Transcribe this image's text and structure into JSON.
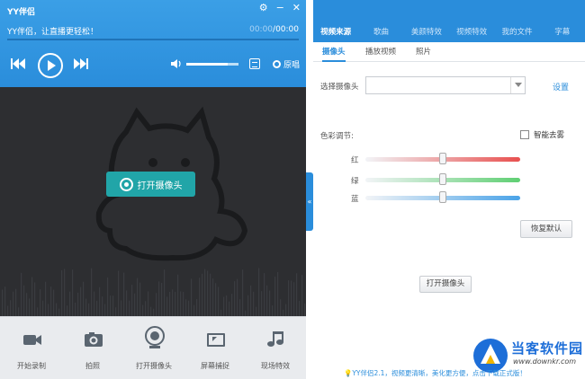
{
  "window": {
    "title": "YY伴侣",
    "controls": [
      "gear-icon",
      "minimize-icon",
      "close-icon"
    ]
  },
  "player": {
    "slogan": "YY伴侣，让直播更轻松！",
    "time_current": "00:00",
    "time_total": "/00:00",
    "volume_level": 0.8,
    "original_label": "原唱",
    "original_selected": true
  },
  "preview": {
    "open_camera_label": "打开摄像头"
  },
  "toolbar": {
    "items": [
      {
        "label": "开始录制",
        "icon": "record-video-icon"
      },
      {
        "label": "拍照",
        "icon": "camera-icon"
      },
      {
        "label": "打开摄像头",
        "icon": "webcam-icon"
      },
      {
        "label": "屏幕捕捉",
        "icon": "screen-capture-icon"
      },
      {
        "label": "现场特效",
        "icon": "music-note-icon"
      }
    ]
  },
  "collapse_label": "«",
  "right": {
    "tabs": [
      "视频来源",
      "歌曲",
      "美颜特效",
      "视频特效",
      "我的文件",
      "字幕"
    ],
    "active_tab": 0,
    "subtabs": [
      "摄像头",
      "播放视频",
      "照片"
    ],
    "active_subtab": 0,
    "select_camera_label": "选择摄像头",
    "select_camera_value": "",
    "settings_link": "设置",
    "color_adjust_label": "色彩调节:",
    "defog_label": "智能去雾",
    "defog_checked": false,
    "sliders": [
      {
        "label": "红",
        "value": 0.5,
        "color_from": "#f2f4f7",
        "color_to": "#e8504f"
      },
      {
        "label": "绿",
        "value": 0.5,
        "color_from": "#f2f4f7",
        "color_to": "#5fcf73"
      },
      {
        "label": "蓝",
        "value": 0.5,
        "color_from": "#f2f4f7",
        "color_to": "#4aa3e8"
      }
    ],
    "restore_default": "恢复默认",
    "open_camera_button": "打开摄像头"
  },
  "footer": {
    "tip": "YY伴侣2.1，视频更清晰，美化更方便，点击下载正式版！",
    "brand_name": "当客软件园",
    "brand_url": "www.downkr.com"
  },
  "colors": {
    "accent": "#2a8ddb",
    "camera_button": "#21a5a8",
    "preview_bg": "#2d2e31"
  }
}
